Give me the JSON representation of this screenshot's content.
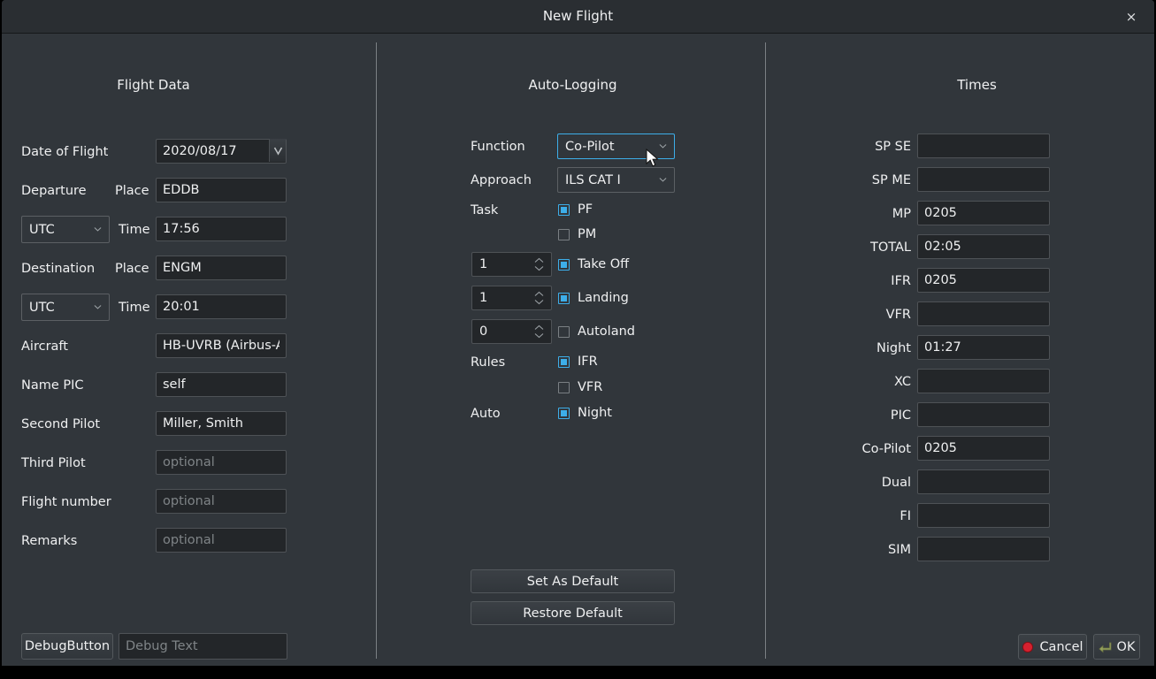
{
  "window": {
    "title": "New Flight",
    "close_label": "×"
  },
  "columns": {
    "flight_data_title": "Flight Data",
    "auto_logging_title": "Auto-Logging",
    "times_title": "Times"
  },
  "flight_data": {
    "date_of_flight": {
      "label": "Date of Flight",
      "value": "2020/08/17"
    },
    "departure": {
      "label": "Departure",
      "place_label": "Place",
      "place_value": "EDDB",
      "tz_value": "UTC",
      "time_label": "Time",
      "time_value": "17:56"
    },
    "destination": {
      "label": "Destination",
      "place_label": "Place",
      "place_value": "ENGM",
      "tz_value": "UTC",
      "time_label": "Time",
      "time_value": "20:01"
    },
    "aircraft": {
      "label": "Aircraft",
      "value": "HB-UVRB (Airbus-A"
    },
    "name_pic": {
      "label": "Name PIC",
      "value": "self"
    },
    "second_pilot": {
      "label": "Second Pilot",
      "value": "Miller, Smith"
    },
    "third_pilot": {
      "label": "Third Pilot",
      "value": "",
      "placeholder": "optional"
    },
    "flight_number": {
      "label": "Flight number",
      "value": "",
      "placeholder": "optional"
    },
    "remarks": {
      "label": "Remarks",
      "value": "",
      "placeholder": "optional"
    },
    "debug_button": "DebugButton",
    "debug_text_placeholder": "Debug Text"
  },
  "auto_logging": {
    "function": {
      "label": "Function",
      "value": "Co-Pilot"
    },
    "approach": {
      "label": "Approach",
      "value": "ILS CAT I"
    },
    "task_label": "Task",
    "rules_label": "Rules",
    "auto_label": "Auto",
    "checkboxes": [
      {
        "name": "pf",
        "label": "PF",
        "checked": true
      },
      {
        "name": "pm",
        "label": "PM",
        "checked": false
      },
      {
        "name": "takeoff",
        "label": "Take Off",
        "checked": true
      },
      {
        "name": "landing",
        "label": "Landing",
        "checked": true
      },
      {
        "name": "autoland",
        "label": "Autoland",
        "checked": false
      },
      {
        "name": "ifr",
        "label": "IFR",
        "checked": true
      },
      {
        "name": "vfr",
        "label": "VFR",
        "checked": false
      },
      {
        "name": "night",
        "label": "Night",
        "checked": true
      }
    ],
    "spinboxes": [
      {
        "name": "takeoff-count",
        "value": "1"
      },
      {
        "name": "landing-count",
        "value": "1"
      },
      {
        "name": "autoland-count",
        "value": "0"
      }
    ],
    "set_as_default": "Set As Default",
    "restore_default": "Restore Default"
  },
  "times": {
    "rows": [
      {
        "label": "SP SE",
        "value": ""
      },
      {
        "label": "SP ME",
        "value": ""
      },
      {
        "label": "MP",
        "value": "0205"
      },
      {
        "label": "TOTAL",
        "value": "02:05"
      },
      {
        "label": "IFR",
        "value": "0205"
      },
      {
        "label": "VFR",
        "value": ""
      },
      {
        "label": "Night",
        "value": "01:27"
      },
      {
        "label": "XC",
        "value": ""
      },
      {
        "label": "PIC",
        "value": ""
      },
      {
        "label": "Co-Pilot",
        "value": "0205"
      },
      {
        "label": "Dual",
        "value": ""
      },
      {
        "label": "FI",
        "value": ""
      },
      {
        "label": "SIM",
        "value": ""
      }
    ]
  },
  "footer": {
    "cancel": "Cancel",
    "ok": "OK"
  },
  "colors": {
    "window_bg": "#31363b",
    "titlebar_bg": "#2a2e32",
    "input_bg": "#232629",
    "text": "#eff0f1",
    "placeholder": "#7f8487",
    "accent": "#3daee9",
    "cancel_icon": "#da4453",
    "ok_icon": "#8a9a5b"
  }
}
